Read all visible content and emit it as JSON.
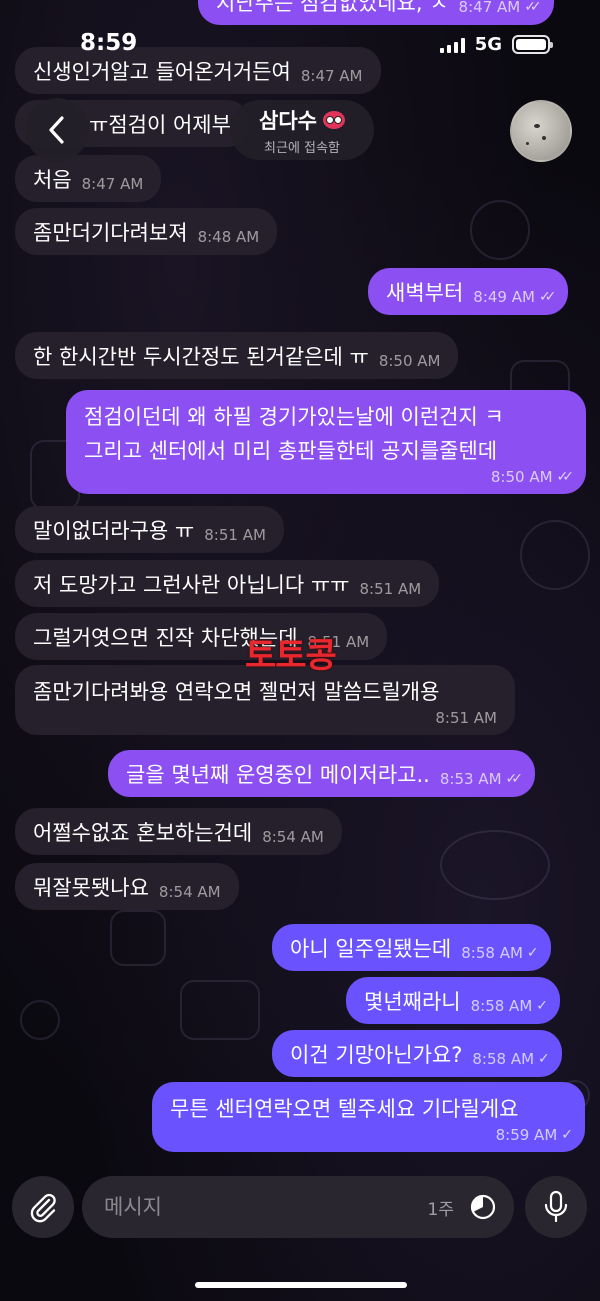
{
  "status_bar": {
    "time": "8:59",
    "network": "5G"
  },
  "header": {
    "back_label": "뒤로",
    "contact_name": "삼다수",
    "contact_status": "최근에 접속함"
  },
  "messages": [
    {
      "dir": "out",
      "text": "지난주는 점검없었네요, ㅈ",
      "time": "8:47 AM"
    },
    {
      "dir": "in",
      "text": "신생인거알고 들어온거거든여",
      "time": "8:47 AM"
    },
    {
      "dir": "in",
      "text": "ㅠ점검이 어제부",
      "time": ""
    },
    {
      "dir": "in",
      "text": "처음",
      "time": "8:47 AM"
    },
    {
      "dir": "in",
      "text": "좀만더기다려보져",
      "time": "8:48 AM"
    },
    {
      "dir": "out",
      "text": "새벽부터",
      "time": "8:49 AM"
    },
    {
      "dir": "in",
      "text": "한 한시간반 두시간정도 된거같은데 ㅠ",
      "time": "8:50 AM"
    },
    {
      "dir": "out",
      "line1": "점검이던데 왜 하필 경기가있는날에 이런건지 ㅋ",
      "line2": "그리고 센터에서 미리 총판들한테 공지를줄텐데",
      "time": "8:50 AM"
    },
    {
      "dir": "in",
      "text": "말이없더라구용 ㅠ",
      "time": "8:51 AM"
    },
    {
      "dir": "in",
      "text": "저 도망가고 그런사란 아닙니다 ㅠㅠ",
      "time": "8:51 AM"
    },
    {
      "dir": "in",
      "text": "그럴거엿으면 진작 차단했는데",
      "time": "8:51 AM"
    },
    {
      "dir": "in",
      "text": "좀만기다려봐용 연락오면 젤먼저 말씀드릴개용",
      "time": "8:51 AM"
    },
    {
      "dir": "out",
      "text": "글을 몇년째 운영중인 메이저라고..",
      "time": "8:53 AM"
    },
    {
      "dir": "in",
      "text": "어쩔수없죠 혼보하는건데",
      "time": "8:54 AM"
    },
    {
      "dir": "in",
      "text": "뭐잘못됏나요",
      "time": "8:54 AM"
    },
    {
      "dir": "out",
      "text": "아니 일주일됐는데",
      "time": "8:58 AM"
    },
    {
      "dir": "out",
      "text": "몇년째라니",
      "time": "8:58 AM"
    },
    {
      "dir": "out",
      "text": "이건 기망아닌가요?",
      "time": "8:58 AM"
    },
    {
      "dir": "out",
      "text": "무튼 센터연락오면 텔주세요 기다릴게요",
      "time": "8:59 AM"
    }
  ],
  "watermark": "토토콩",
  "composer": {
    "placeholder": "메시지",
    "timer_label": "1주"
  },
  "colors": {
    "incoming_bubble": "#25202c",
    "outgoing_bubble": "#8b4ff2",
    "outgoing_bubble_latest": "#6a52ff",
    "watermark": "#e8282e"
  }
}
